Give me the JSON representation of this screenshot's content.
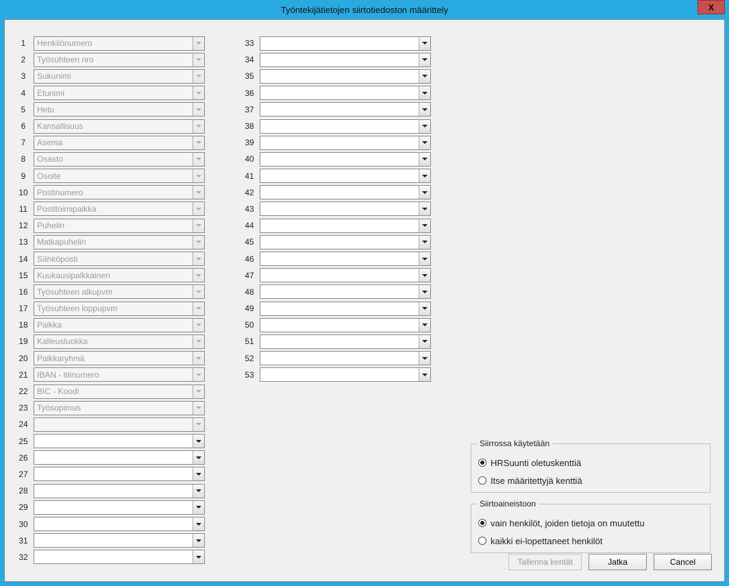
{
  "window": {
    "title": "Työntekijätietojen siirtotiedoston  määrittely",
    "close_label": "X"
  },
  "fields_col1": [
    {
      "num": "1",
      "label": "Henkilönumero",
      "disabled": true
    },
    {
      "num": "2",
      "label": "Työsuhteen nro",
      "disabled": true
    },
    {
      "num": "3",
      "label": "Sukunimi",
      "disabled": true
    },
    {
      "num": "4",
      "label": "Etunimi",
      "disabled": true
    },
    {
      "num": "5",
      "label": "Hetu",
      "disabled": true
    },
    {
      "num": "6",
      "label": "Kansallisuus",
      "disabled": true
    },
    {
      "num": "7",
      "label": "Asema",
      "disabled": true
    },
    {
      "num": "8",
      "label": "Osasto",
      "disabled": true
    },
    {
      "num": "9",
      "label": "Osoite",
      "disabled": true
    },
    {
      "num": "10",
      "label": "Postinumero",
      "disabled": true
    },
    {
      "num": "11",
      "label": "Postitoimipaikka",
      "disabled": true
    },
    {
      "num": "12",
      "label": "Puhelin",
      "disabled": true
    },
    {
      "num": "13",
      "label": "Matkapuhelin",
      "disabled": true
    },
    {
      "num": "14",
      "label": "Sähköposti",
      "disabled": true
    },
    {
      "num": "15",
      "label": "Kuukausipalkkainen",
      "disabled": true
    },
    {
      "num": "16",
      "label": "Työsuhteen alkupvm",
      "disabled": true
    },
    {
      "num": "17",
      "label": "Työsuhteen loppupvm",
      "disabled": true
    },
    {
      "num": "18",
      "label": "Palkka",
      "disabled": true
    },
    {
      "num": "19",
      "label": "Kalleusluokka",
      "disabled": true
    },
    {
      "num": "20",
      "label": "Palkkaryhmä",
      "disabled": true
    },
    {
      "num": "21",
      "label": "IBAN - tilinumero",
      "disabled": true
    },
    {
      "num": "22",
      "label": "BIC - Koodi",
      "disabled": true
    },
    {
      "num": "23",
      "label": "Työsopimus",
      "disabled": true
    },
    {
      "num": "24",
      "label": "",
      "disabled": true
    },
    {
      "num": "25",
      "label": "",
      "disabled": false,
      "focused": true
    },
    {
      "num": "26",
      "label": "",
      "disabled": false
    },
    {
      "num": "27",
      "label": "",
      "disabled": false
    },
    {
      "num": "28",
      "label": "",
      "disabled": false
    },
    {
      "num": "29",
      "label": "",
      "disabled": false
    },
    {
      "num": "30",
      "label": "",
      "disabled": false
    },
    {
      "num": "31",
      "label": "",
      "disabled": false
    },
    {
      "num": "32",
      "label": "",
      "disabled": false
    }
  ],
  "fields_col2": [
    {
      "num": "33",
      "label": "",
      "disabled": false
    },
    {
      "num": "34",
      "label": "",
      "disabled": false
    },
    {
      "num": "35",
      "label": "",
      "disabled": false
    },
    {
      "num": "36",
      "label": "",
      "disabled": false
    },
    {
      "num": "37",
      "label": "",
      "disabled": false
    },
    {
      "num": "38",
      "label": "",
      "disabled": false
    },
    {
      "num": "39",
      "label": "",
      "disabled": false
    },
    {
      "num": "40",
      "label": "",
      "disabled": false
    },
    {
      "num": "41",
      "label": "",
      "disabled": false
    },
    {
      "num": "42",
      "label": "",
      "disabled": false
    },
    {
      "num": "43",
      "label": "",
      "disabled": false
    },
    {
      "num": "44",
      "label": "",
      "disabled": false
    },
    {
      "num": "45",
      "label": "",
      "disabled": false
    },
    {
      "num": "46",
      "label": "",
      "disabled": false
    },
    {
      "num": "47",
      "label": "",
      "disabled": false
    },
    {
      "num": "48",
      "label": "",
      "disabled": false
    },
    {
      "num": "49",
      "label": "",
      "disabled": false
    },
    {
      "num": "50",
      "label": "",
      "disabled": false
    },
    {
      "num": "51",
      "label": "",
      "disabled": false
    },
    {
      "num": "52",
      "label": "",
      "disabled": false
    },
    {
      "num": "53",
      "label": "",
      "disabled": false
    }
  ],
  "group_transfer_uses": {
    "legend": "Siirrossa käytetään",
    "option1": "HRSuunti oletuskenttiä",
    "option2": "Itse määritettyjä kenttiä",
    "selected": 1
  },
  "group_transfer_material": {
    "legend": "Siirtoaineistoon",
    "option1": "vain henkilöt, joiden tietoja on muutettu",
    "option2": "kaikki ei-lopettaneet henkilöt",
    "selected": 1
  },
  "buttons": {
    "save_fields": "Tallenna kentät",
    "continue": "Jatka",
    "cancel": "Cancel"
  }
}
